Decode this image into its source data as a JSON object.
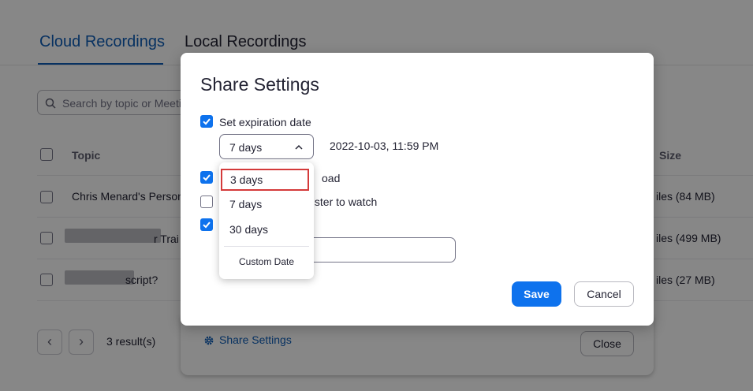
{
  "tabs": {
    "cloud": "Cloud Recordings",
    "local": "Local Recordings"
  },
  "search": {
    "placeholder": "Search by topic or Meeti"
  },
  "table": {
    "headers": {
      "topic": "Topic",
      "size": "Size"
    },
    "rows": [
      {
        "topic": "Chris Menard's Person",
        "size": "iles (84 MB)"
      },
      {
        "topic": "r Trai",
        "size": "iles (499 MB)"
      },
      {
        "topic": "script?",
        "size": "iles (27 MB)"
      }
    ]
  },
  "pagination": {
    "prev": "‹",
    "next": "›",
    "results": "3 result(s)"
  },
  "footer": {
    "share_settings": "Share Settings",
    "close": "Close"
  },
  "modal": {
    "title": "Share Settings",
    "expiration": {
      "label": "Set expiration date",
      "checked": true,
      "select_value": "7 days",
      "date": "2022-10-03, 11:59 PM"
    },
    "options": [
      {
        "label": "oad",
        "checked": true
      },
      {
        "label": "gister to watch",
        "checked": false
      },
      {
        "label": "",
        "checked": true
      }
    ],
    "save": "Save",
    "cancel": "Cancel"
  },
  "dropdown": {
    "items": [
      "3 days",
      "7 days",
      "30 days"
    ],
    "selected": "3 days",
    "custom": "Custom Date"
  },
  "colors": {
    "brand": "#0e72ed",
    "link": "#0e5eb8",
    "highlight": "#d43a3a"
  }
}
